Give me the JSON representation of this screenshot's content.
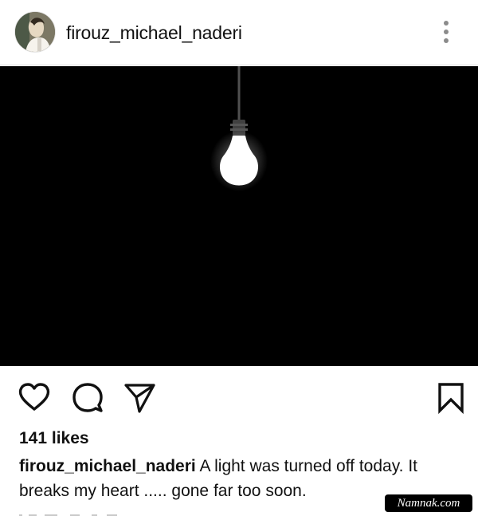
{
  "post": {
    "username": "firouz_michael_naderi",
    "likes": "141 likes",
    "caption": {
      "username": "firouz_michael_naderi",
      "text": "A light was turned off today. It breaks my heart ..... gone far too soon."
    },
    "media": {
      "description_icon": "light-bulb"
    }
  },
  "icons": {
    "more": "more-vertical-icon",
    "like": "heart-icon",
    "comment": "comment-icon",
    "share": "send-icon",
    "save": "bookmark-icon"
  },
  "watermark": "Namnak.com",
  "colors": {
    "text": "#111111",
    "media_background": "#000000",
    "bulb": "#ffffff"
  }
}
